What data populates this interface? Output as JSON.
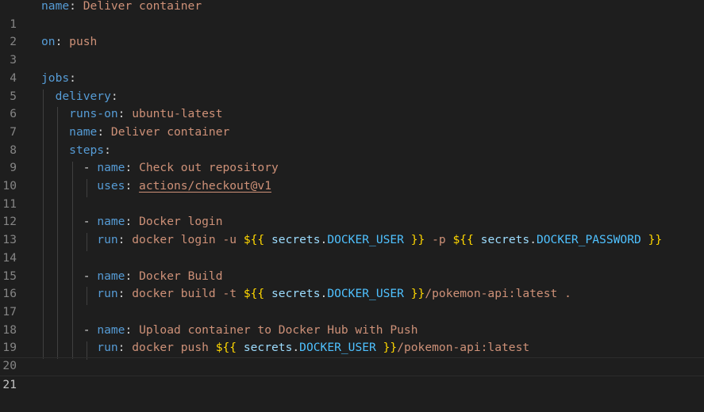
{
  "editor": {
    "line_numbers": [
      "1",
      "2",
      "3",
      "4",
      "5",
      "6",
      "7",
      "8",
      "9",
      "10",
      "11",
      "12",
      "13",
      "14",
      "15",
      "16",
      "17",
      "18",
      "19",
      "20",
      "21"
    ],
    "current_line": "21"
  },
  "yaml": {
    "workflow_key": "name",
    "workflow_name": "Deliver container",
    "on_key": "on",
    "on_value": "push",
    "jobs_key": "jobs",
    "job_id": "delivery",
    "runs_on_key": "runs-on",
    "runs_on_value": "ubuntu-latest",
    "job_name_key": "name",
    "job_name_value": "Deliver container",
    "steps_key": "steps",
    "dash": "-",
    "colon": ":",
    "open_brace": "${{",
    "close_brace": "}}",
    "secrets_obj": "secrets",
    "dot": ".",
    "step1": {
      "name_key": "name",
      "name_value": "Check out repository",
      "uses_key": "uses",
      "uses_value": "actions/checkout@v1"
    },
    "step2": {
      "name_key": "name",
      "name_value": "Docker login",
      "run_key": "run",
      "run_prefix": "docker login -u",
      "user_secret": "DOCKER_USER",
      "mid": "-p",
      "pass_secret": "DOCKER_PASSWORD"
    },
    "step3": {
      "name_key": "name",
      "name_value": "Docker Build",
      "run_key": "run",
      "run_prefix": "docker build -t",
      "user_secret": "DOCKER_USER",
      "run_suffix": "/pokemon-api:latest ."
    },
    "step4": {
      "name_key": "name",
      "name_value": "Upload container to Docker Hub with Push",
      "run_key": "run",
      "run_prefix": "docker push",
      "user_secret": "DOCKER_USER",
      "run_suffix": "/pokemon-api:latest"
    }
  },
  "colors": {
    "background": "#1e1e1e",
    "key": "#569cd6",
    "string": "#ce9178",
    "brace": "#ffd700",
    "secrets": "#9cdcfe",
    "line_number": "#858585"
  }
}
